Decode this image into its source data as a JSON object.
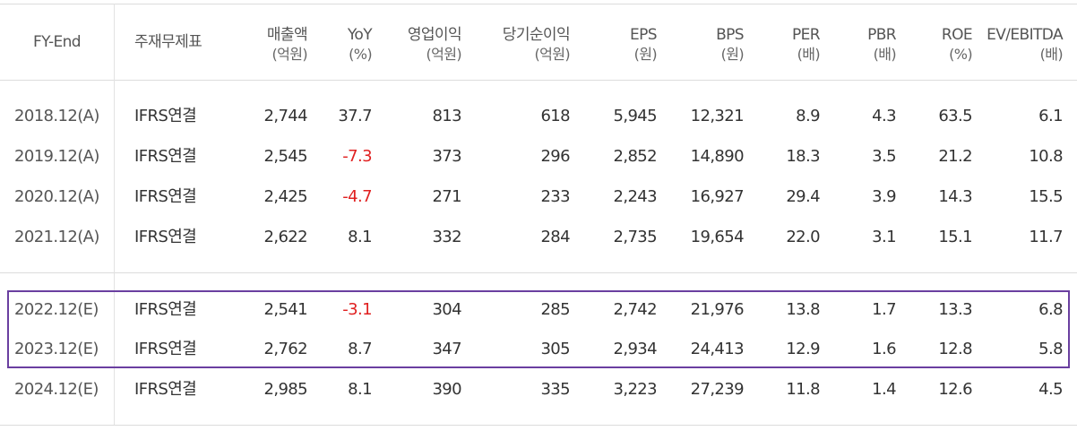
{
  "headers": {
    "fy": "FY-End",
    "basis": "주재무제표",
    "sales": {
      "label": "매출액",
      "unit": "(억원)"
    },
    "yoy": {
      "label": "YoY",
      "unit": "(%)"
    },
    "op": {
      "label": "영업이익",
      "unit": "(억원)"
    },
    "net": {
      "label": "당기순이익",
      "unit": "(억원)"
    },
    "eps": {
      "label": "EPS",
      "unit": "(원)"
    },
    "bps": {
      "label": "BPS",
      "unit": "(원)"
    },
    "per": {
      "label": "PER",
      "unit": "(배)"
    },
    "pbr": {
      "label": "PBR",
      "unit": "(배)"
    },
    "roe": {
      "label": "ROE",
      "unit": "(%)"
    },
    "ev": {
      "label": "EV/EBITDA",
      "unit": "(배)"
    }
  },
  "rows": [
    {
      "fy": "2018.12(A)",
      "basis": "IFRS연결",
      "sales": "2,744",
      "yoy": "37.7",
      "op": "813",
      "net": "618",
      "eps": "5,945",
      "bps": "12,321",
      "per": "8.9",
      "pbr": "4.3",
      "roe": "63.5",
      "ev": "6.1"
    },
    {
      "fy": "2019.12(A)",
      "basis": "IFRS연결",
      "sales": "2,545",
      "yoy": "-7.3",
      "op": "373",
      "net": "296",
      "eps": "2,852",
      "bps": "14,890",
      "per": "18.3",
      "pbr": "3.5",
      "roe": "21.2",
      "ev": "10.8"
    },
    {
      "fy": "2020.12(A)",
      "basis": "IFRS연결",
      "sales": "2,425",
      "yoy": "-4.7",
      "op": "271",
      "net": "233",
      "eps": "2,243",
      "bps": "16,927",
      "per": "29.4",
      "pbr": "3.9",
      "roe": "14.3",
      "ev": "15.5"
    },
    {
      "fy": "2021.12(A)",
      "basis": "IFRS연결",
      "sales": "2,622",
      "yoy": "8.1",
      "op": "332",
      "net": "284",
      "eps": "2,735",
      "bps": "19,654",
      "per": "22.0",
      "pbr": "3.1",
      "roe": "15.1",
      "ev": "11.7"
    },
    {
      "fy": "2022.12(E)",
      "basis": "IFRS연결",
      "sales": "2,541",
      "yoy": "-3.1",
      "op": "304",
      "net": "285",
      "eps": "2,742",
      "bps": "21,976",
      "per": "13.8",
      "pbr": "1.7",
      "roe": "13.3",
      "ev": "6.8"
    },
    {
      "fy": "2023.12(E)",
      "basis": "IFRS연결",
      "sales": "2,762",
      "yoy": "8.7",
      "op": "347",
      "net": "305",
      "eps": "2,934",
      "bps": "24,413",
      "per": "12.9",
      "pbr": "1.6",
      "roe": "12.8",
      "ev": "5.8"
    },
    {
      "fy": "2024.12(E)",
      "basis": "IFRS연결",
      "sales": "2,985",
      "yoy": "8.1",
      "op": "390",
      "net": "335",
      "eps": "3,223",
      "bps": "27,239",
      "per": "11.8",
      "pbr": "1.4",
      "roe": "12.6",
      "ev": "4.5"
    }
  ],
  "colors": {
    "negative": "#e02020",
    "highlight_border": "#6a3fa0"
  }
}
